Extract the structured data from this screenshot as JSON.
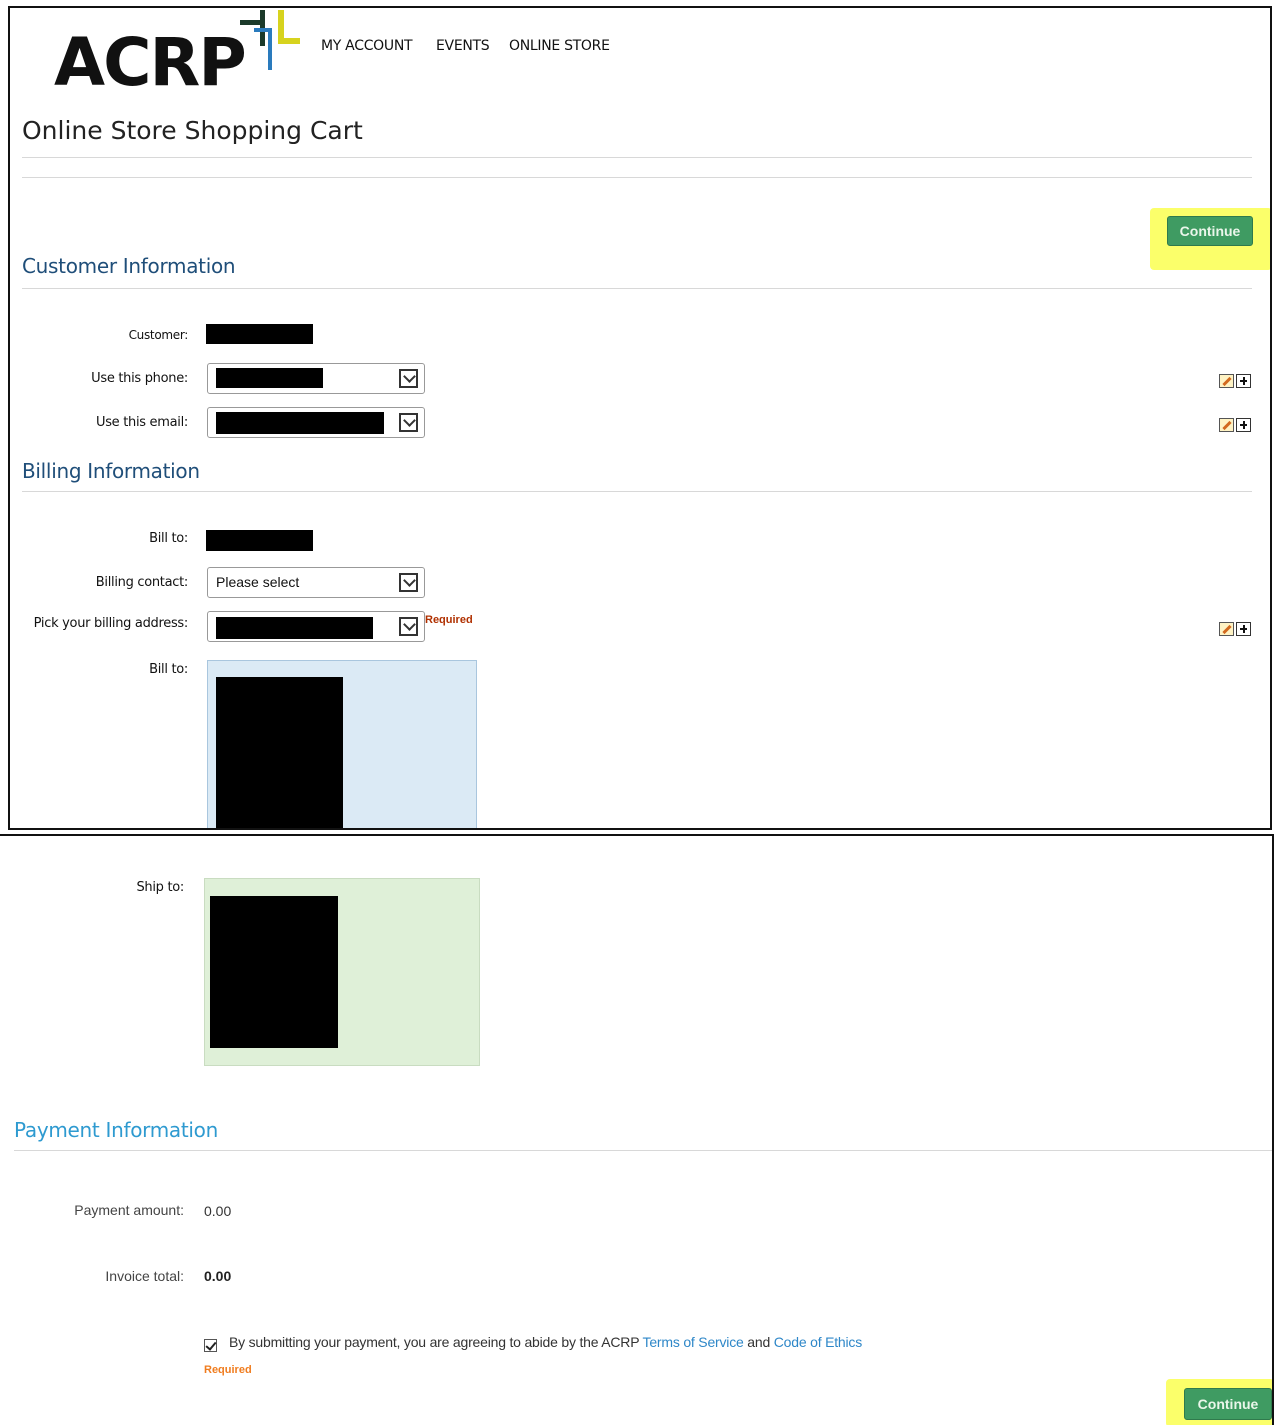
{
  "brand": {
    "logo_text": "ACRP"
  },
  "nav": {
    "items": [
      "MY ACCOUNT",
      "EVENTS",
      "ONLINE STORE"
    ]
  },
  "page_title": "Online Store Shopping Cart",
  "buttons": {
    "continue": "Continue"
  },
  "customer_information": {
    "heading": "Customer Information",
    "customer_label": "Customer:",
    "phone_label": "Use this phone:",
    "email_label": "Use this email:"
  },
  "billing_information": {
    "heading": "Billing Information",
    "bill_to_label": "Bill to:",
    "billing_contact_label": "Billing contact:",
    "billing_contact_value": "Please select",
    "billing_address_label": "Pick your billing address:",
    "required": "Required",
    "bill_to_box_label": "Bill to:"
  },
  "shipping": {
    "ship_to_label": "Ship to:"
  },
  "payment_information": {
    "heading": "Payment Information",
    "payment_amount_label": "Payment amount:",
    "payment_amount_value": "0.00",
    "invoice_total_label": "Invoice total:",
    "invoice_total_value": "0.00",
    "terms_prefix": "By submitting your payment, you are agreeing to abide by the ACRP ",
    "terms_link": "Terms of Service",
    "terms_and": " and ",
    "ethics_link": "Code of Ethics",
    "terms_checked": true,
    "required": "Required"
  },
  "colors": {
    "section_heading": "#1f4e79",
    "payment_heading": "#2e9ad0",
    "button_green": "#3f9b62",
    "highlight": "#fbff6a",
    "bill_box": "#dbeaf5",
    "ship_box": "#dff0d8",
    "required_red": "#b03000",
    "required_orange": "#f07c1e",
    "link": "#2e87c8"
  }
}
